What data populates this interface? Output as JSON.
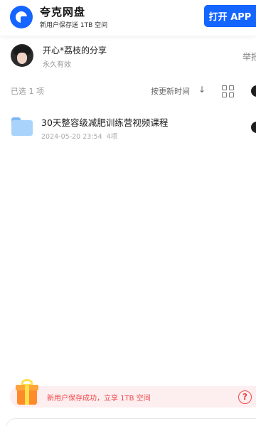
{
  "header": {
    "app_name": "夸克网盘",
    "slogan": "新用户保存送 1TB 空间",
    "open_app_label": "打开 APP",
    "logo_icon": "quark-logo-icon",
    "brand_color": "#1565ff"
  },
  "sharer": {
    "name": "开心*荔枝的分享",
    "validity": "永久有效",
    "report_label": "举报"
  },
  "toolbar": {
    "selected_count": "已选 1 项",
    "sort_label": "按更新时间",
    "sort_icon": "arrow-down-icon",
    "view_icon": "grid-view-icon"
  },
  "files": [
    {
      "name": "30天整容级减肥训练营视频课程",
      "date": "2024-05-20 23:54",
      "count": "4项",
      "icon": "folder-icon",
      "selected": true
    }
  ],
  "promo": {
    "text": "新用户保存成功，立享 1TB 空间",
    "help_glyph": "?",
    "color": "#f04848"
  }
}
